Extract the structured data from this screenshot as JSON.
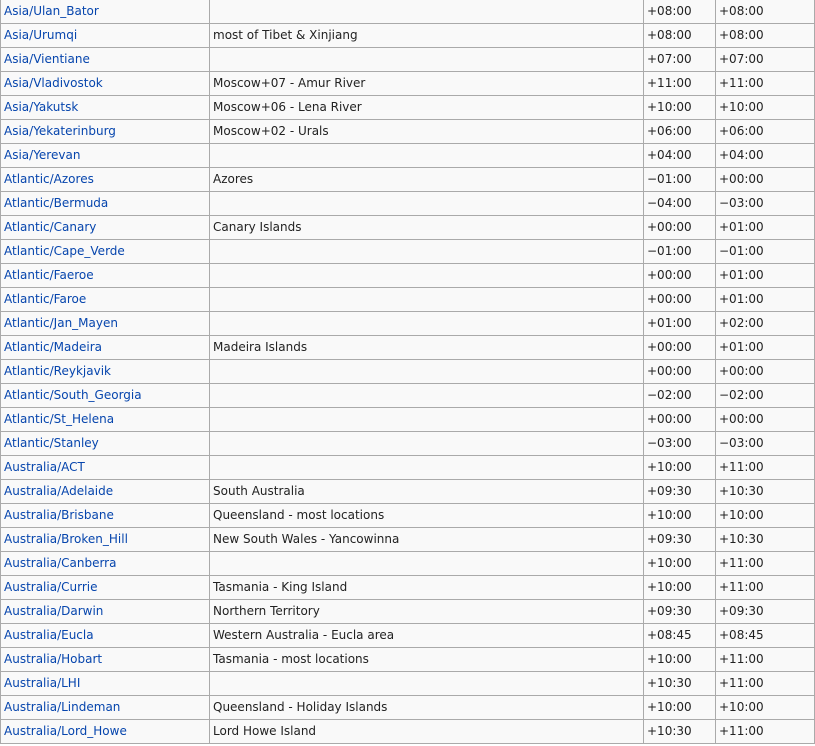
{
  "colors": {
    "link": "#0645ad",
    "border": "#aaaaaa",
    "row_background": "#f9f9f9",
    "text": "#222222"
  },
  "rows": [
    {
      "zone": "Asia/Ulan_Bator",
      "description": "",
      "utc_offset": "+08:00",
      "dst_offset": "+08:00"
    },
    {
      "zone": "Asia/Urumqi",
      "description": "most of Tibet & Xinjiang",
      "utc_offset": "+08:00",
      "dst_offset": "+08:00"
    },
    {
      "zone": "Asia/Vientiane",
      "description": "",
      "utc_offset": "+07:00",
      "dst_offset": "+07:00"
    },
    {
      "zone": "Asia/Vladivostok",
      "description": "Moscow+07 - Amur River",
      "utc_offset": "+11:00",
      "dst_offset": "+11:00"
    },
    {
      "zone": "Asia/Yakutsk",
      "description": "Moscow+06 - Lena River",
      "utc_offset": "+10:00",
      "dst_offset": "+10:00"
    },
    {
      "zone": "Asia/Yekaterinburg",
      "description": "Moscow+02 - Urals",
      "utc_offset": "+06:00",
      "dst_offset": "+06:00"
    },
    {
      "zone": "Asia/Yerevan",
      "description": "",
      "utc_offset": "+04:00",
      "dst_offset": "+04:00"
    },
    {
      "zone": "Atlantic/Azores",
      "description": "Azores",
      "utc_offset": "−01:00",
      "dst_offset": "+00:00"
    },
    {
      "zone": "Atlantic/Bermuda",
      "description": "",
      "utc_offset": "−04:00",
      "dst_offset": "−03:00"
    },
    {
      "zone": "Atlantic/Canary",
      "description": "Canary Islands",
      "utc_offset": "+00:00",
      "dst_offset": "+01:00"
    },
    {
      "zone": "Atlantic/Cape_Verde",
      "description": "",
      "utc_offset": "−01:00",
      "dst_offset": "−01:00"
    },
    {
      "zone": "Atlantic/Faeroe",
      "description": "",
      "utc_offset": "+00:00",
      "dst_offset": "+01:00"
    },
    {
      "zone": "Atlantic/Faroe",
      "description": "",
      "utc_offset": "+00:00",
      "dst_offset": "+01:00"
    },
    {
      "zone": "Atlantic/Jan_Mayen",
      "description": "",
      "utc_offset": "+01:00",
      "dst_offset": "+02:00"
    },
    {
      "zone": "Atlantic/Madeira",
      "description": "Madeira Islands",
      "utc_offset": "+00:00",
      "dst_offset": "+01:00"
    },
    {
      "zone": "Atlantic/Reykjavik",
      "description": "",
      "utc_offset": "+00:00",
      "dst_offset": "+00:00"
    },
    {
      "zone": "Atlantic/South_Georgia",
      "description": "",
      "utc_offset": "−02:00",
      "dst_offset": "−02:00"
    },
    {
      "zone": "Atlantic/St_Helena",
      "description": "",
      "utc_offset": "+00:00",
      "dst_offset": "+00:00"
    },
    {
      "zone": "Atlantic/Stanley",
      "description": "",
      "utc_offset": "−03:00",
      "dst_offset": "−03:00"
    },
    {
      "zone": "Australia/ACT",
      "description": "",
      "utc_offset": "+10:00",
      "dst_offset": "+11:00"
    },
    {
      "zone": "Australia/Adelaide",
      "description": "South Australia",
      "utc_offset": "+09:30",
      "dst_offset": "+10:30"
    },
    {
      "zone": "Australia/Brisbane",
      "description": "Queensland - most locations",
      "utc_offset": "+10:00",
      "dst_offset": "+10:00"
    },
    {
      "zone": "Australia/Broken_Hill",
      "description": "New South Wales - Yancowinna",
      "utc_offset": "+09:30",
      "dst_offset": "+10:30"
    },
    {
      "zone": "Australia/Canberra",
      "description": "",
      "utc_offset": "+10:00",
      "dst_offset": "+11:00"
    },
    {
      "zone": "Australia/Currie",
      "description": "Tasmania - King Island",
      "utc_offset": "+10:00",
      "dst_offset": "+11:00"
    },
    {
      "zone": "Australia/Darwin",
      "description": "Northern Territory",
      "utc_offset": "+09:30",
      "dst_offset": "+09:30"
    },
    {
      "zone": "Australia/Eucla",
      "description": "Western Australia - Eucla area",
      "utc_offset": "+08:45",
      "dst_offset": "+08:45"
    },
    {
      "zone": "Australia/Hobart",
      "description": "Tasmania - most locations",
      "utc_offset": "+10:00",
      "dst_offset": "+11:00"
    },
    {
      "zone": "Australia/LHI",
      "description": "",
      "utc_offset": "+10:30",
      "dst_offset": "+11:00"
    },
    {
      "zone": "Australia/Lindeman",
      "description": "Queensland - Holiday Islands",
      "utc_offset": "+10:00",
      "dst_offset": "+10:00"
    },
    {
      "zone": "Australia/Lord_Howe",
      "description": "Lord Howe Island",
      "utc_offset": "+10:30",
      "dst_offset": "+11:00"
    }
  ]
}
